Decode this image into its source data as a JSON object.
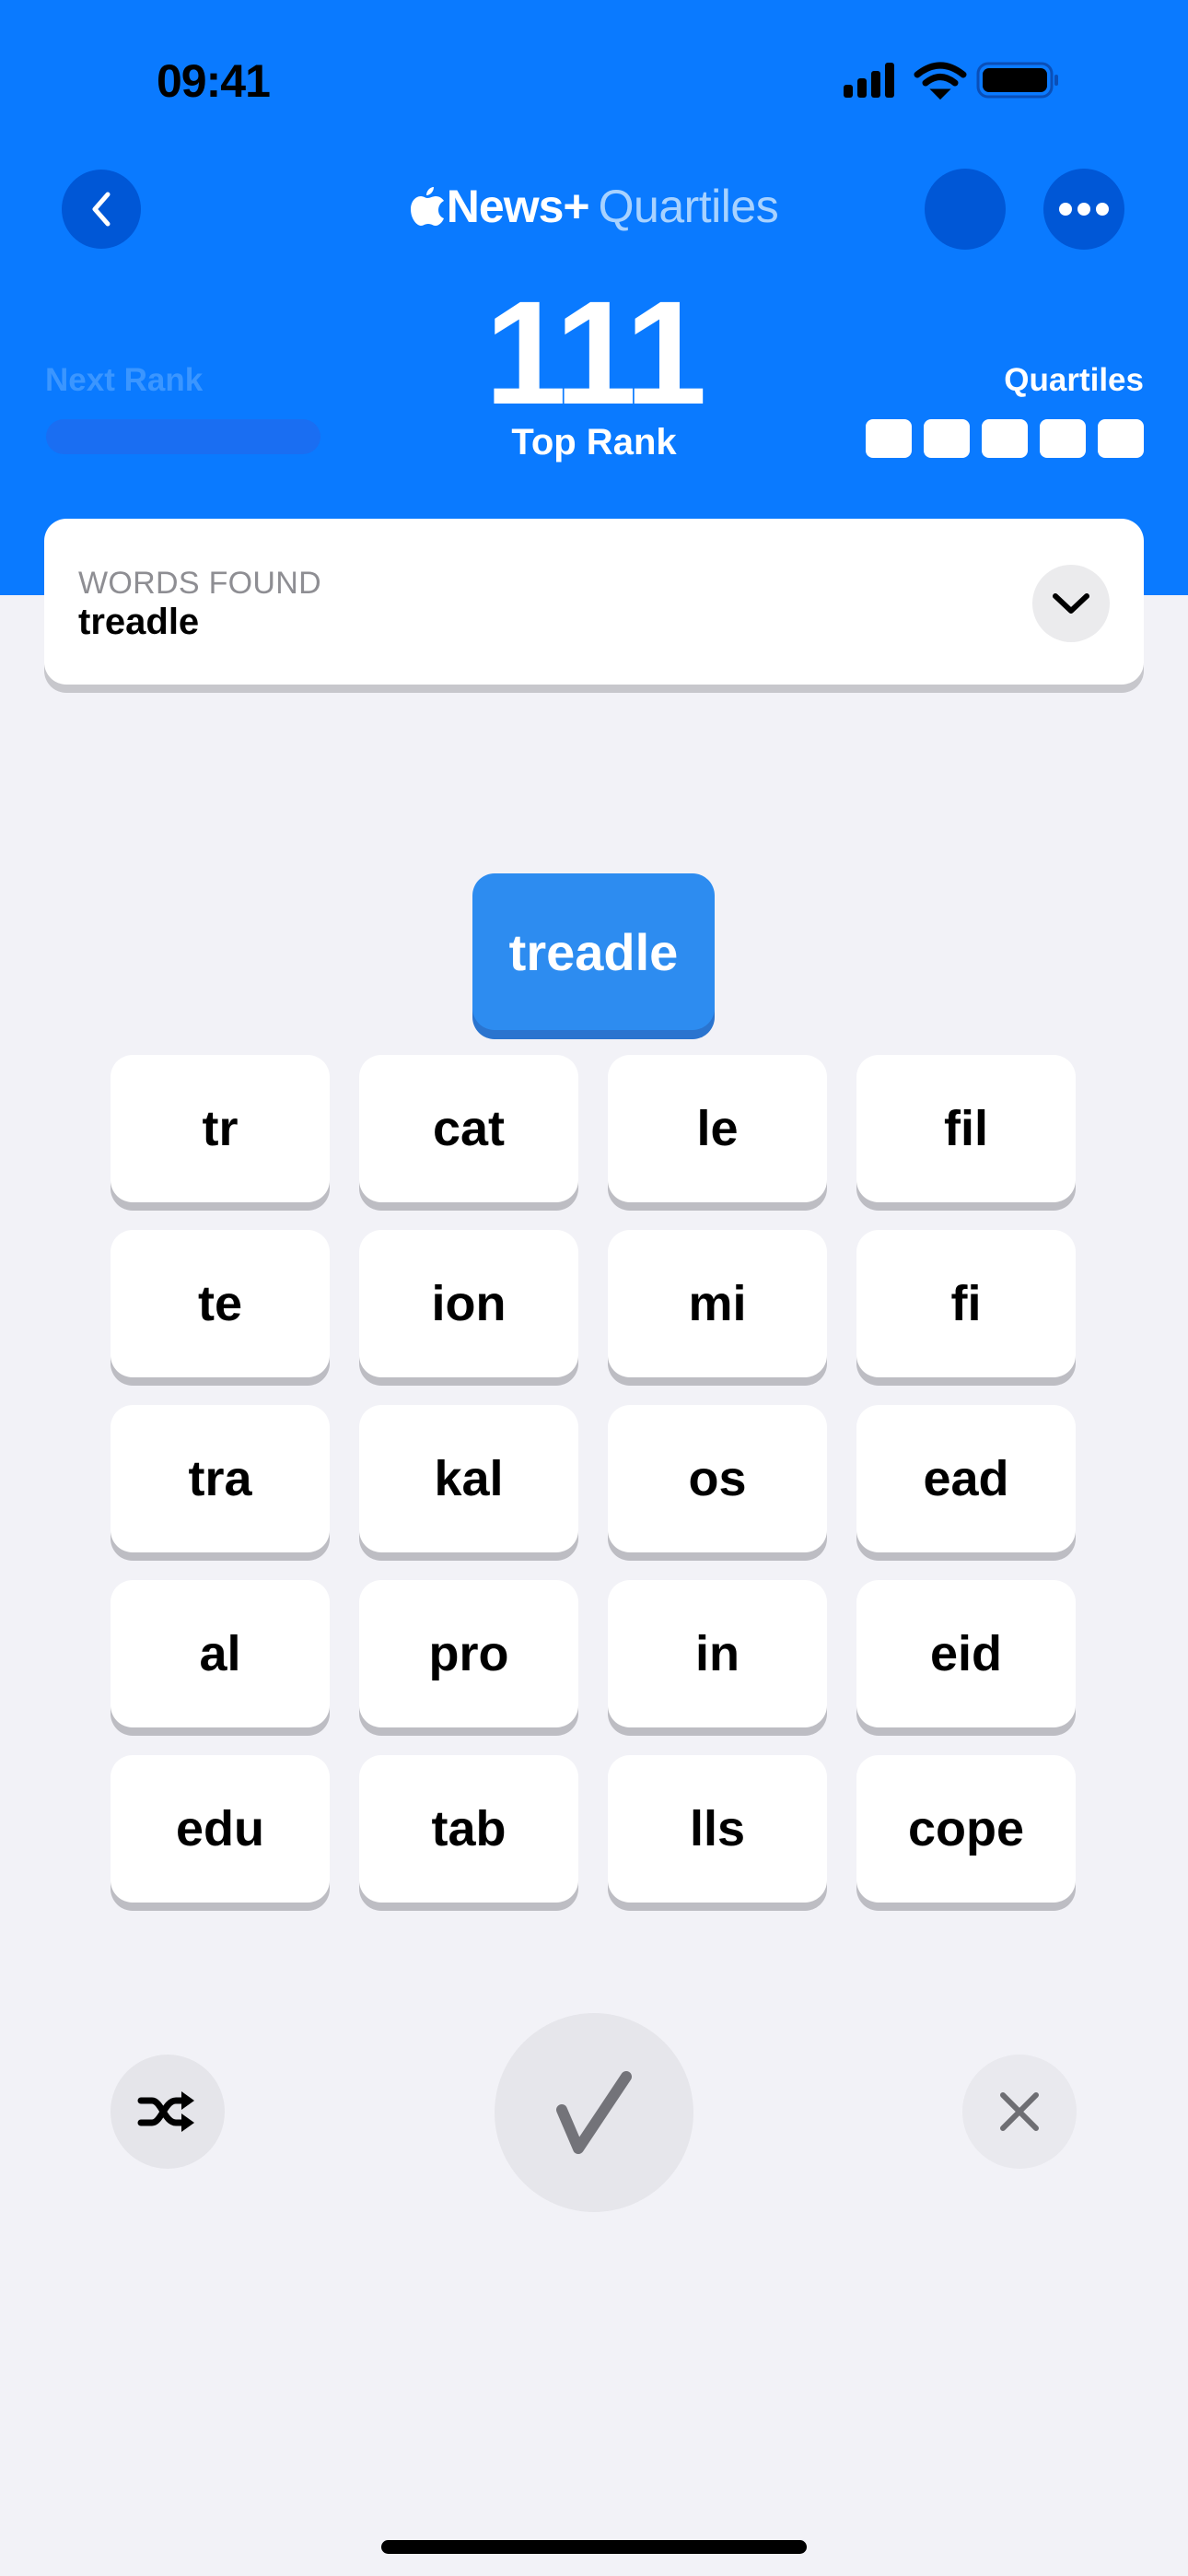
{
  "status_bar": {
    "time": "09:41",
    "icons": [
      "cellular-signal-icon",
      "wifi-icon",
      "battery-icon"
    ]
  },
  "nav": {
    "back_icon": "chevron-left-icon",
    "brand": "News+",
    "brand_logo": "apple-logo-icon",
    "title": "Quartiles",
    "more_icon": "ellipsis-icon"
  },
  "scoreboard": {
    "next_rank_label": "Next Rank",
    "next_rank_progress": 0,
    "score": "111",
    "rank_label": "Top Rank",
    "quartiles_label": "Quartiles",
    "quartiles_total": 5,
    "quartiles_found": 0
  },
  "words_found": {
    "label": "WORDS FOUND",
    "value": "treadle",
    "toggle_icon": "chevron-down-icon"
  },
  "current_word": "treadle",
  "tiles": [
    "tr",
    "cat",
    "le",
    "fil",
    "te",
    "ion",
    "mi",
    "fi",
    "tra",
    "kal",
    "os",
    "ead",
    "al",
    "pro",
    "in",
    "eid",
    "edu",
    "tab",
    "lls",
    "cope"
  ],
  "controls": {
    "shuffle_icon": "shuffle-icon",
    "submit_icon": "checkmark-icon",
    "clear_icon": "close-icon"
  },
  "colors": {
    "header_blue": "#0A7AFF",
    "button_blue": "#0057D6",
    "selected_tile": "#2D8CF0",
    "title_accent": "#A8D2FF",
    "background": "#F2F2F7"
  }
}
